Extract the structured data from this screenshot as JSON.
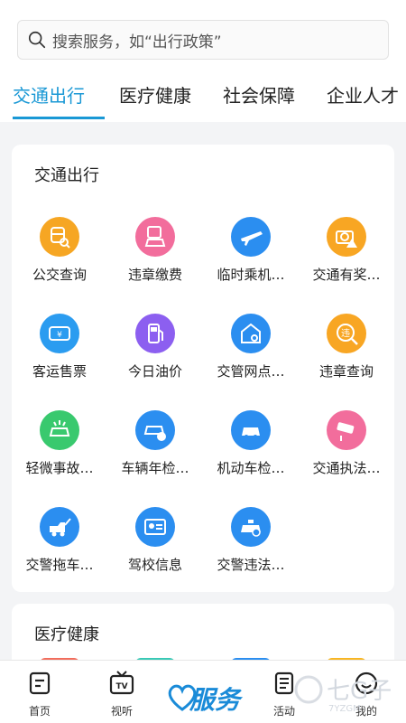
{
  "search": {
    "placeholder": "搜索服务，如“出行政策”"
  },
  "tabs": [
    {
      "label": "交通出行",
      "active": true
    },
    {
      "label": "医疗健康",
      "active": false
    },
    {
      "label": "社会保障",
      "active": false
    },
    {
      "label": "企业人才",
      "active": false
    }
  ],
  "section1": {
    "title": "交通出行",
    "items": [
      {
        "label": "公交查询",
        "icon": "bus-search-icon",
        "color": "#f6a623"
      },
      {
        "label": "违章缴费",
        "icon": "car-payment-icon",
        "color": "#f26d9c"
      },
      {
        "label": "临时乘机…",
        "icon": "airplane-icon",
        "color": "#2b8ef0"
      },
      {
        "label": "交通有奖…",
        "icon": "camera-warning-icon",
        "color": "#f8a623"
      },
      {
        "label": "客运售票",
        "icon": "ticket-icon",
        "color": "#2b9cf0"
      },
      {
        "label": "今日油价",
        "icon": "fuel-pump-icon",
        "color": "#8c5ff0"
      },
      {
        "label": "交管网点…",
        "icon": "building-search-icon",
        "color": "#2b8ef0"
      },
      {
        "label": "违章查询",
        "icon": "violation-search-icon",
        "color": "#f8a623"
      },
      {
        "label": "轻微事故…",
        "icon": "car-accident-icon",
        "color": "#39c96e"
      },
      {
        "label": "车辆年检…",
        "icon": "vehicle-inspection-icon",
        "color": "#2b8ef0"
      },
      {
        "label": "机动车检…",
        "icon": "motor-vehicle-check-icon",
        "color": "#2b8ef0"
      },
      {
        "label": "交通执法…",
        "icon": "surveillance-camera-icon",
        "color": "#f26d9c"
      },
      {
        "label": "交警拖车…",
        "icon": "tow-truck-icon",
        "color": "#2b8ef0"
      },
      {
        "label": "驾校信息",
        "icon": "id-card-icon",
        "color": "#2b8ef0"
      },
      {
        "label": "交警违法…",
        "icon": "police-car-icon",
        "color": "#2b8ef0"
      }
    ]
  },
  "section2": {
    "title": "医疗健康"
  },
  "bottom_nav": {
    "home": "首页",
    "video": "视听",
    "service": "服务",
    "activity": "活动",
    "mine": "我的"
  },
  "watermark": {
    "text": "七G子",
    "sub": "7YZGM"
  }
}
